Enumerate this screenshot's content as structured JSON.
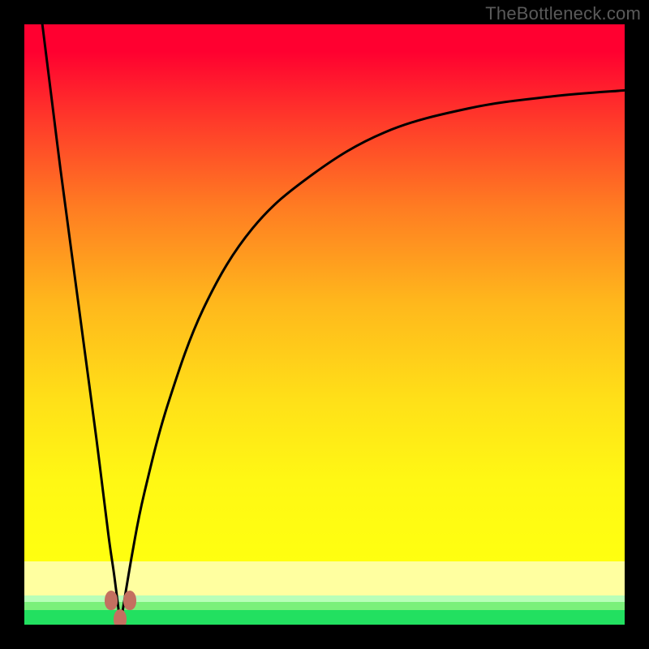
{
  "watermark": "TheBottleneck.com",
  "colors": {
    "frame": "#000000",
    "gradient_top": "#ff0030",
    "gradient_bottom": "#ffff10",
    "light_yellow": "#ffffa0",
    "pale_green": "#b8ffb8",
    "mid_green": "#7af07a",
    "sat_green": "#22e060",
    "curve": "#000000",
    "marker": "#c47060"
  },
  "chart_data": {
    "type": "line",
    "title": "",
    "xlabel": "",
    "ylabel": "",
    "xlim": [
      0,
      100
    ],
    "ylim": [
      0,
      100
    ],
    "min_x": 16,
    "series": [
      {
        "name": "left-branch",
        "x": [
          3,
          4,
          5,
          6,
          8,
          10,
          12,
          14,
          15,
          16
        ],
        "values": [
          100,
          92,
          84,
          76,
          61,
          46,
          31,
          15,
          8,
          0
        ]
      },
      {
        "name": "right-branch",
        "x": [
          16,
          18,
          20,
          24,
          30,
          38,
          48,
          60,
          74,
          88,
          100
        ],
        "values": [
          0,
          12,
          22,
          37,
          53,
          66,
          75,
          82,
          86,
          88,
          89
        ]
      }
    ],
    "markers": [
      {
        "x": 14.5,
        "y": 4
      },
      {
        "x": 16.0,
        "y": 1
      },
      {
        "x": 17.5,
        "y": 4
      }
    ]
  }
}
